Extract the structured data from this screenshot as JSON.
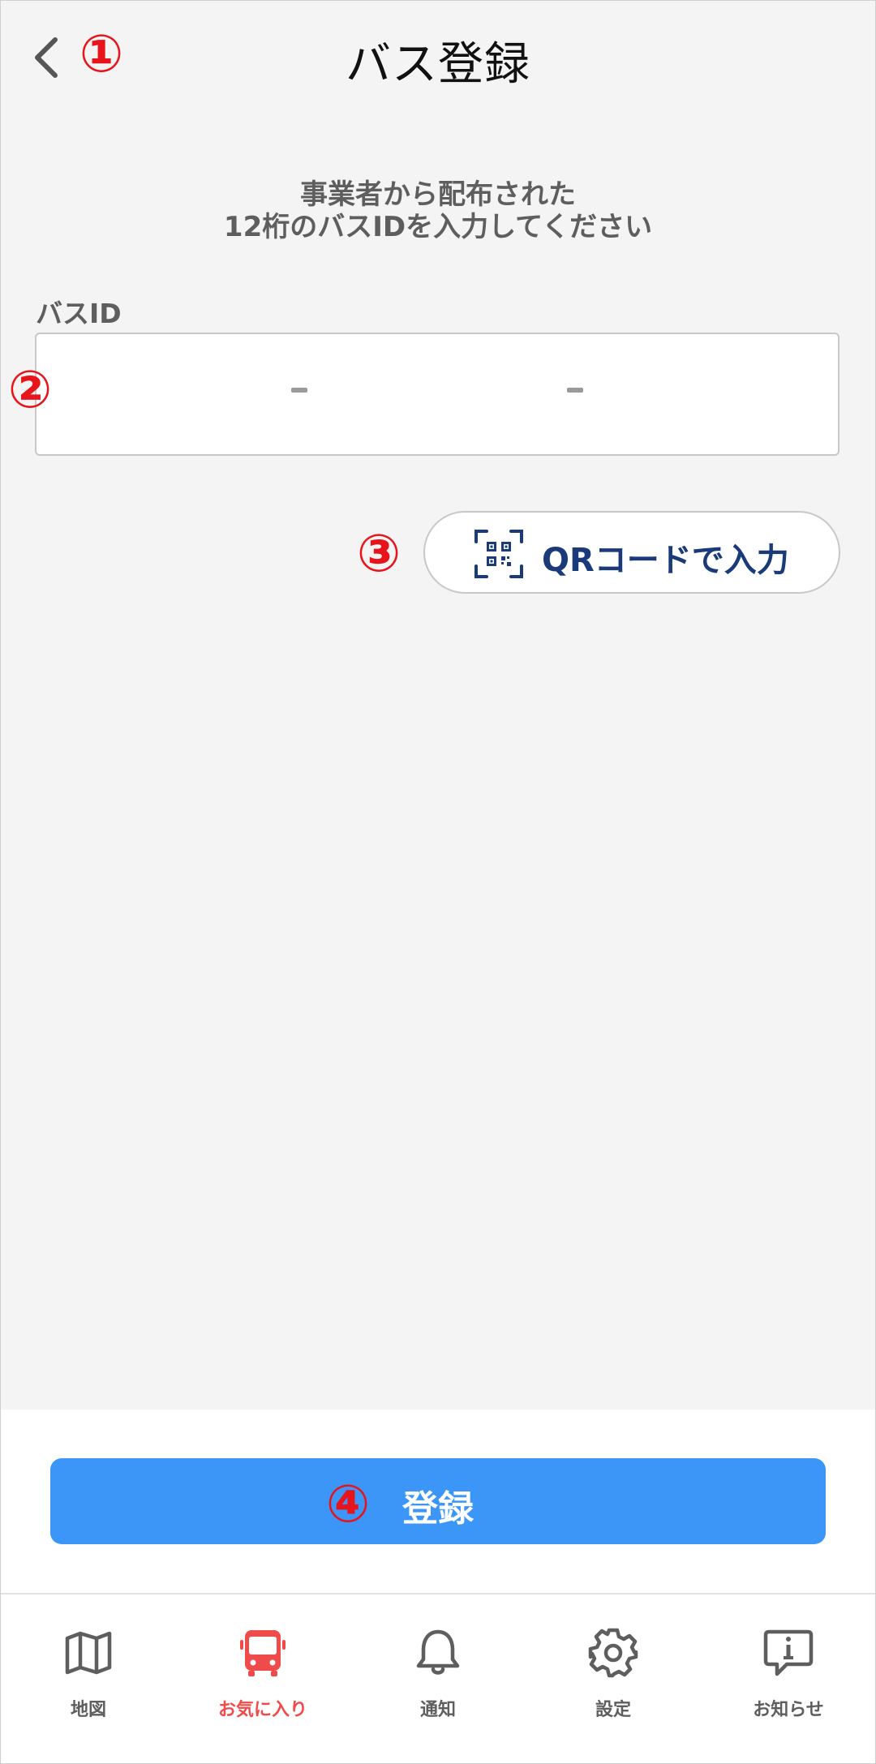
{
  "header": {
    "title": "バス登録",
    "back_icon": "chevron-left-icon"
  },
  "annotations": {
    "a1": "①",
    "a2": "②",
    "a3": "③",
    "a4": "④"
  },
  "instruction": {
    "line1": "事業者から配布された",
    "line2": "12桁のバスIDを入力してください"
  },
  "bus_id_field": {
    "label": "バスID",
    "separator1": "-",
    "separator2": "-"
  },
  "qr_button": {
    "label": "QRコードで入力",
    "icon": "qr-scan-icon"
  },
  "register_button": {
    "label": "登録"
  },
  "tabbar": {
    "items": [
      {
        "label": "地図",
        "icon": "map-icon"
      },
      {
        "label": "お気に入り",
        "icon": "bus-icon",
        "active": true
      },
      {
        "label": "通知",
        "icon": "bell-icon"
      },
      {
        "label": "設定",
        "icon": "gear-icon"
      },
      {
        "label": "お知らせ",
        "icon": "info-message-icon"
      }
    ]
  },
  "colors": {
    "accent_blue": "#3b96f7",
    "active_tab_red": "#f04b4b",
    "annotation_red": "#e8141b",
    "qr_text_navy": "#1b3a7a",
    "background": "#f4f4f4"
  }
}
